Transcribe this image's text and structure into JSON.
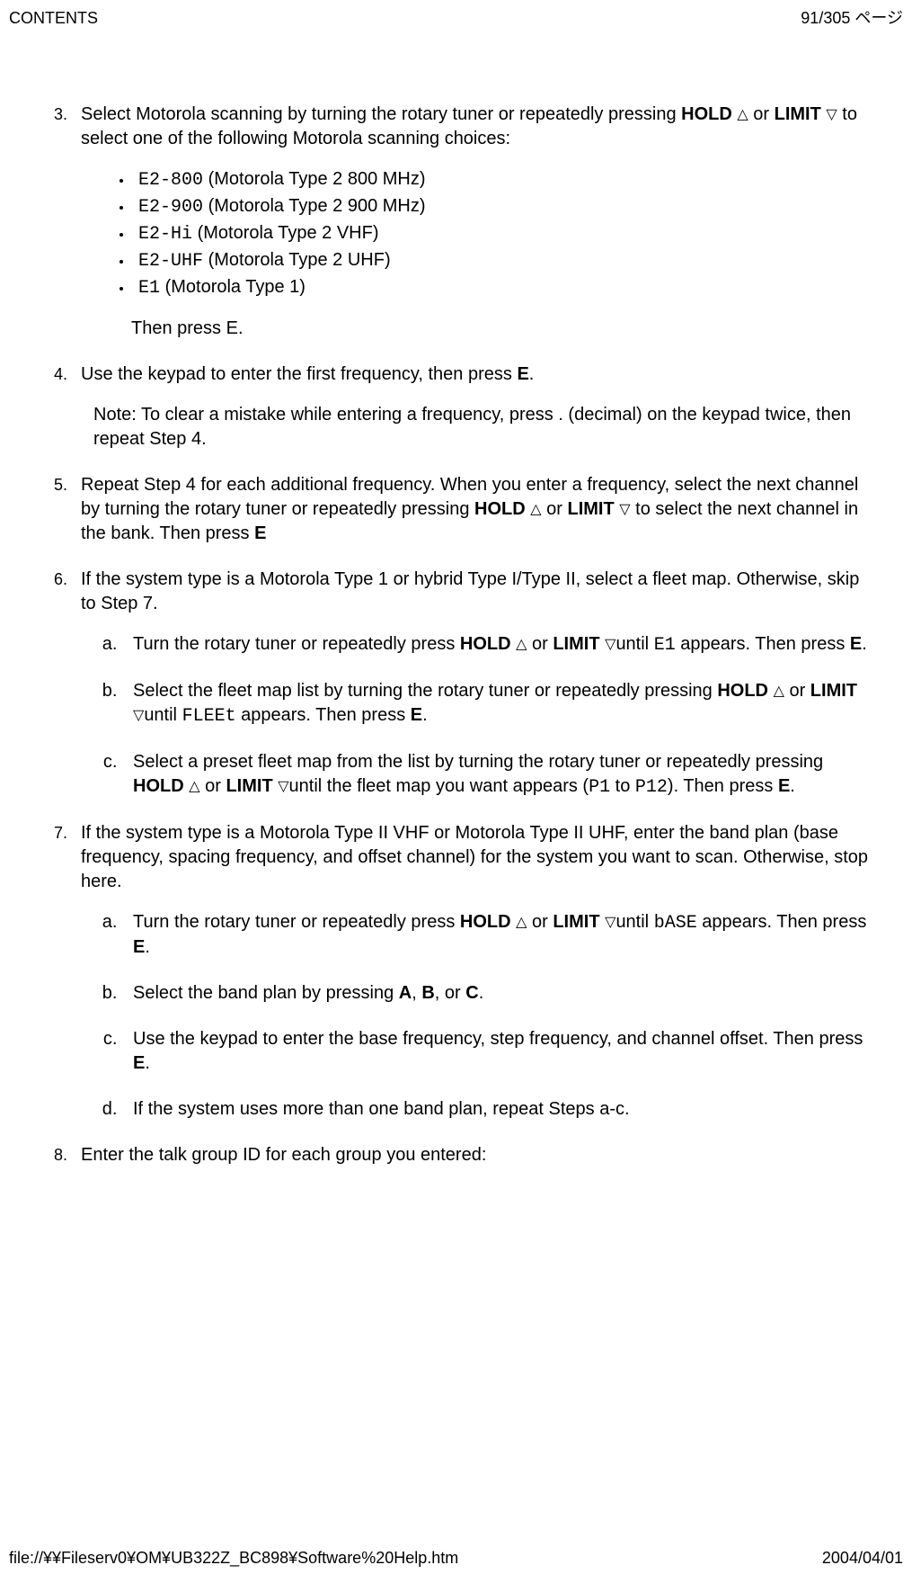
{
  "header": {
    "left": "CONTENTS",
    "right": "91/305 ページ"
  },
  "footer": {
    "left": "file://¥¥Fileserv0¥OM¥UB322Z_BC898¥Software%20Help.htm",
    "right": "2004/04/01"
  },
  "tri_up": "△",
  "tri_down": "▽",
  "step3": {
    "lead_a": "Select Motorola scanning by turning the rotary tuner or repeatedly pressing ",
    "hold": "HOLD",
    "lead_b": " or ",
    "limit": "LIMIT",
    "lead_c": " to select one of the following Motorola scanning choices:",
    "choices": [
      {
        "code": "E2-800",
        "desc": " (Motorola Type 2 800 MHz)"
      },
      {
        "code": "E2-900",
        "desc": " (Motorola Type 2 900 MHz)"
      },
      {
        "code": "E2-Hi",
        "desc": " (Motorola Type 2 VHF)"
      },
      {
        "code": "E2-UHF",
        "desc": " (Motorola Type 2 UHF)"
      },
      {
        "code": "E1",
        "desc": " (Motorola Type 1)"
      }
    ],
    "then": "Then press E."
  },
  "step4": {
    "a": "Use the keypad to enter the first frequency, then press ",
    "E": "E",
    "dot": ".",
    "note": "Note: To clear a mistake while entering a frequency, press . (decimal) on the keypad twice, then repeat Step 4."
  },
  "step5": {
    "a": "Repeat Step 4 for each additional frequency. When you enter a frequency, select the next channel by turning the rotary tuner or repeatedly pressing ",
    "hold": "HOLD",
    "or": " or ",
    "limit": "LIMIT",
    "b": " to select the next channel in the bank. Then press ",
    "E": "E"
  },
  "step6": {
    "lead": "If the system type is a Motorola Type 1 or hybrid Type I/Type II, select a fleet map. Otherwise, skip to Step 7.",
    "a": {
      "p1": "Turn the rotary tuner or repeatedly press ",
      "hold": "HOLD",
      "or": " or ",
      "limit": "LIMIT",
      "p2": "until ",
      "e1": "E1",
      "p3": " appears. Then press ",
      "E": "E",
      "dot": "."
    },
    "b": {
      "p1": "Select the fleet map list by turning the rotary tuner or repeatedly pressing ",
      "hold": "HOLD",
      "or": " or ",
      "limit": "LIMIT",
      "p2": "until ",
      "flee": "FLEEt",
      "p3": " appears. Then press ",
      "E": "E",
      "dot": "."
    },
    "c": {
      "p1": "Select a preset fleet map from the list by turning the rotary tuner or repeatedly pressing ",
      "hold": "HOLD",
      "or": " or ",
      "limit": "LIMIT",
      "p2": "until the fleet map you want appears (",
      "p1code": "P1",
      "to": " to ",
      "p12code": "P12",
      "p3": "). Then press ",
      "E": "E",
      "dot": "."
    }
  },
  "step7": {
    "lead": "If the system type is a Motorola Type II VHF or Motorola Type II UHF, enter the band plan (base frequency, spacing frequency, and offset channel) for the system you want to scan.  Otherwise, stop here.",
    "a": {
      "p1": "Turn the rotary tuner or repeatedly press ",
      "hold": "HOLD",
      "or": " or ",
      "limit": "LIMIT",
      "p2": "until ",
      "base": "bASE",
      "p3": " appears. Then press ",
      "E": "E",
      "dot": "."
    },
    "b": {
      "p1": "Select the band plan by pressing ",
      "A": "A",
      "c1": ", ",
      "B": "B",
      "c2": ", or ",
      "C": "C",
      "dot": "."
    },
    "c": {
      "p1": "Use the keypad to enter the base frequency, step frequency, and channel offset. Then press ",
      "E": "E",
      "dot": "."
    },
    "d": "If the system uses more than one band plan, repeat Steps a-c."
  },
  "step8": "Enter the talk group ID for each group you entered:"
}
